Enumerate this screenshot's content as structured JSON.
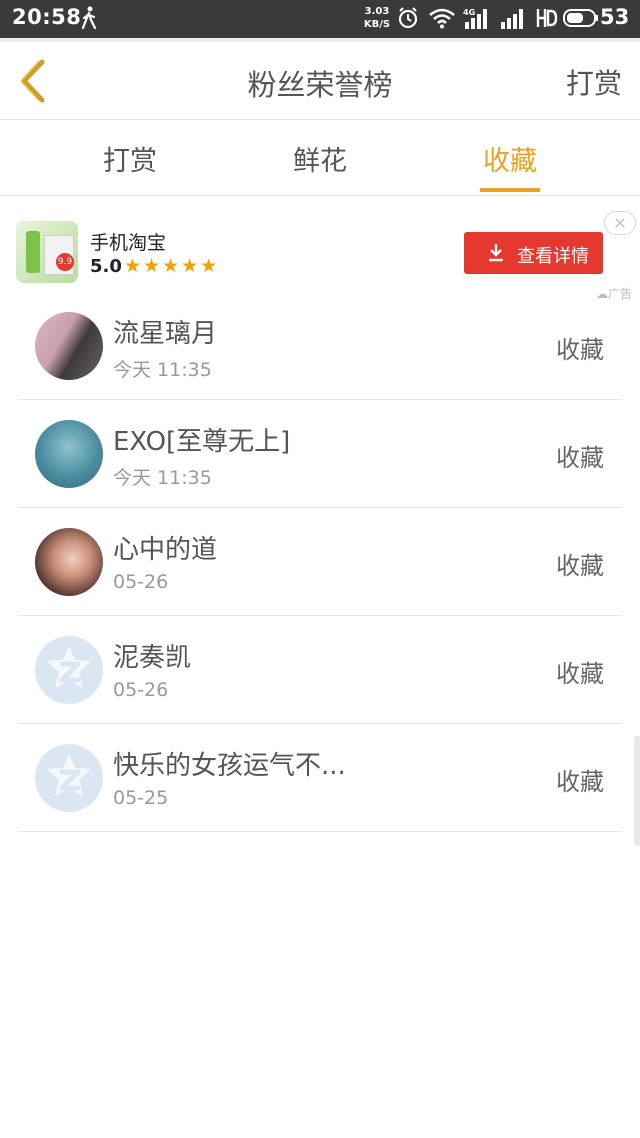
{
  "status_bar": {
    "time": "20:58",
    "net_speed_value": "3.03",
    "net_speed_unit": "KB/S",
    "battery": "53"
  },
  "header": {
    "title": "粉丝荣誉榜",
    "action": "打赏"
  },
  "tabs": [
    {
      "label": "打赏",
      "active": false
    },
    {
      "label": "鲜花",
      "active": false
    },
    {
      "label": "收藏",
      "active": true
    }
  ],
  "ad": {
    "app_name": "手机淘宝",
    "rating": "5.0",
    "stars": "★★★★★",
    "button_label": "查看详情",
    "close_glyph": "×",
    "ad_label": "广告",
    "image_tag": "9.9"
  },
  "list": [
    {
      "name": "流星璃月",
      "time": "今天 11:35",
      "action": "收藏",
      "avatar": "photo-couple"
    },
    {
      "name": "EXO[至尊无上]",
      "time": "今天 11:35",
      "action": "收藏",
      "avatar": "photo-sea"
    },
    {
      "name": "心中的道",
      "time": "05-26",
      "action": "收藏",
      "avatar": "photo-girl"
    },
    {
      "name": "泥奏凯",
      "time": "05-26",
      "action": "收藏",
      "avatar": "default-qzone"
    },
    {
      "name": "快乐的女孩运气不...",
      "time": "05-25",
      "action": "收藏",
      "avatar": "default-qzone"
    }
  ],
  "colors": {
    "accent": "#e8a321",
    "ad_button": "#e5392f",
    "star": "#f4a100"
  }
}
